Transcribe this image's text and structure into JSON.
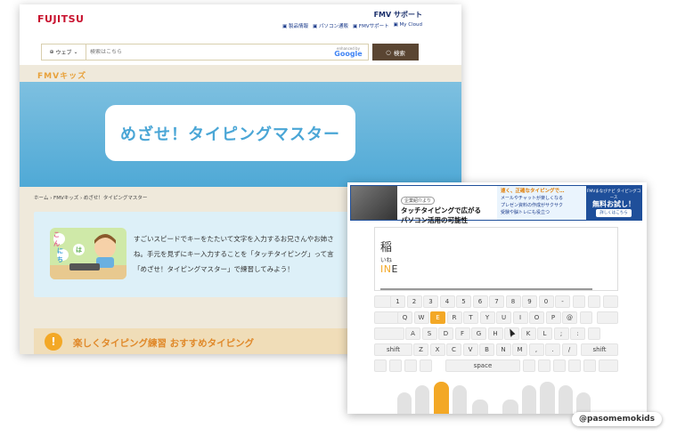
{
  "header": {
    "brand": "FUJITSU",
    "support": "FMV サポート",
    "links": [
      "製品情報",
      "パソコン通販",
      "FMVサポート",
      "My Cloud"
    ]
  },
  "search": {
    "scope": "ウェブ",
    "placeholder": "検索はこちら",
    "enhanced_by": "enhanced by",
    "google": "Google",
    "button": "検索"
  },
  "kids_logo": "FMVキッズ",
  "hero": {
    "title": "めざせ！タイピングマスター"
  },
  "breadcrumb": "ホーム › FMVキッズ › めざせ！タイピングマスター",
  "intro": {
    "bubbles": [
      "こん",
      "にち",
      "は"
    ],
    "lines": [
      "すごいスピードでキーをたたいて文字を入力するお兄さんやお姉さ",
      "ね。手元を見ずにキー入力することを「タッチタイピング」って言",
      "「めざせ！タイピングマスター」で練習してみよう！"
    ]
  },
  "recommend": {
    "icon": "!",
    "text": "楽しくタイピング練習 おすすめタイピング"
  },
  "ad": {
    "tag": "企業紹介より",
    "headline1": "タッチタイピングで広がる",
    "headline2": "パソコン活用の可能性",
    "sub": "速く、正確なタイピングで…",
    "points": [
      "メールやチャットが楽しくなる",
      "プレゼン資料の作成がサクサク",
      "受験や脳トレにも役立つ"
    ],
    "cta_small": "FMVまなびナビ タイピングコース",
    "cta_big": "無料お試し！",
    "cta_btn": "詳しくはこちら"
  },
  "typing": {
    "word": "稲",
    "reading": "いね",
    "typed": "IN",
    "remaining": "E",
    "progress": 0.87
  },
  "keyboard": {
    "row1": [
      "1",
      "2",
      "3",
      "4",
      "5",
      "6",
      "7",
      "8",
      "9",
      "0",
      "-"
    ],
    "row2": [
      "Q",
      "W",
      "E",
      "R",
      "T",
      "Y",
      "U",
      "I",
      "O",
      "P",
      "@"
    ],
    "row3": [
      "A",
      "S",
      "D",
      "F",
      "G",
      "H",
      "J",
      "K",
      "L",
      ";",
      ":"
    ],
    "row4_left": "shift",
    "row4": [
      "Z",
      "X",
      "C",
      "V",
      "B",
      "N",
      "M",
      ",",
      ".",
      "/"
    ],
    "row4_right": "shift",
    "space": "space",
    "active_key": "E"
  },
  "watermark": "@pasomemokids",
  "colors": {
    "accent": "#f3a826",
    "hero": "#4fa9d6",
    "brand": "#c8102e"
  }
}
